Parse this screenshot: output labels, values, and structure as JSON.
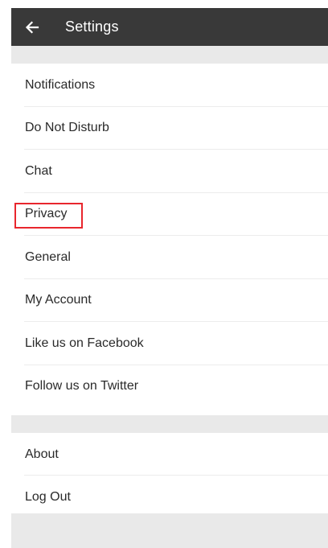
{
  "toolbar": {
    "title": "Settings",
    "back_icon": "arrow-left-icon",
    "background": "#393939"
  },
  "settings_items": [
    {
      "label": "Notifications"
    },
    {
      "label": "Do Not Disturb"
    },
    {
      "label": "Chat"
    },
    {
      "label": "Privacy",
      "highlighted": true
    },
    {
      "label": "General"
    },
    {
      "label": "My Account"
    },
    {
      "label": "Like us on Facebook"
    },
    {
      "label": "Follow us on Twitter"
    }
  ],
  "footer_items": [
    {
      "label": "About"
    },
    {
      "label": "Log Out"
    }
  ],
  "colors": {
    "section_gap": "#e9e9e9",
    "highlight_border": "#e8262d"
  }
}
